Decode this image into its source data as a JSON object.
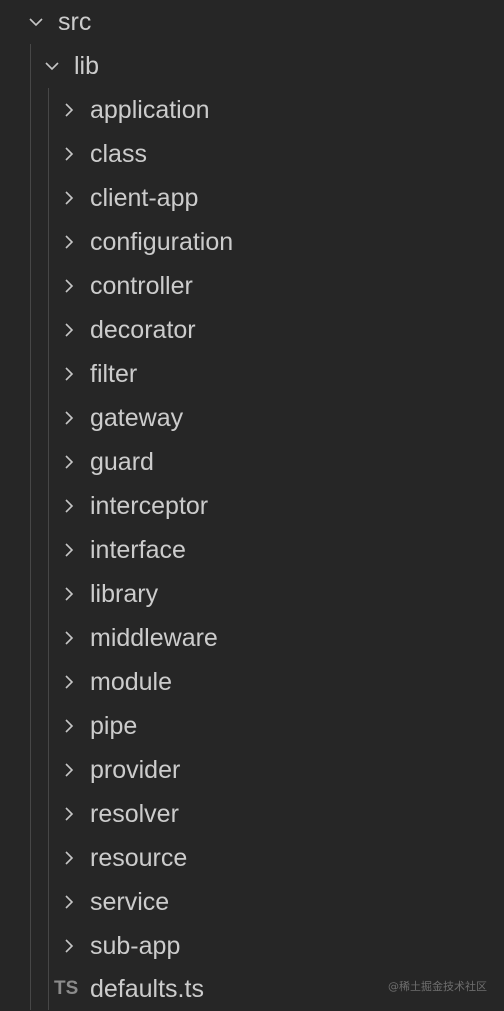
{
  "tree": {
    "root": {
      "label": "src",
      "expanded": true,
      "icon": "chevron-down-icon"
    },
    "lib": {
      "label": "lib",
      "expanded": true,
      "icon": "chevron-down-icon"
    },
    "folders": [
      {
        "label": "application",
        "icon": "chevron-right-icon"
      },
      {
        "label": "class",
        "icon": "chevron-right-icon"
      },
      {
        "label": "client-app",
        "icon": "chevron-right-icon"
      },
      {
        "label": "configuration",
        "icon": "chevron-right-icon"
      },
      {
        "label": "controller",
        "icon": "chevron-right-icon"
      },
      {
        "label": "decorator",
        "icon": "chevron-right-icon"
      },
      {
        "label": "filter",
        "icon": "chevron-right-icon"
      },
      {
        "label": "gateway",
        "icon": "chevron-right-icon"
      },
      {
        "label": "guard",
        "icon": "chevron-right-icon"
      },
      {
        "label": "interceptor",
        "icon": "chevron-right-icon"
      },
      {
        "label": "interface",
        "icon": "chevron-right-icon"
      },
      {
        "label": "library",
        "icon": "chevron-right-icon"
      },
      {
        "label": "middleware",
        "icon": "chevron-right-icon"
      },
      {
        "label": "module",
        "icon": "chevron-right-icon"
      },
      {
        "label": "pipe",
        "icon": "chevron-right-icon"
      },
      {
        "label": "provider",
        "icon": "chevron-right-icon"
      },
      {
        "label": "resolver",
        "icon": "chevron-right-icon"
      },
      {
        "label": "resource",
        "icon": "chevron-right-icon"
      },
      {
        "label": "service",
        "icon": "chevron-right-icon"
      },
      {
        "label": "sub-app",
        "icon": "chevron-right-icon"
      }
    ],
    "file": {
      "label": "defaults.ts",
      "icon_text": "TS",
      "icon": "typescript-file-icon"
    }
  },
  "watermark": "@稀土掘金技术社区",
  "colors": {
    "background": "#262626",
    "text": "#cccccc",
    "guide": "#474747",
    "ts_icon": "#8b8b8b"
  }
}
